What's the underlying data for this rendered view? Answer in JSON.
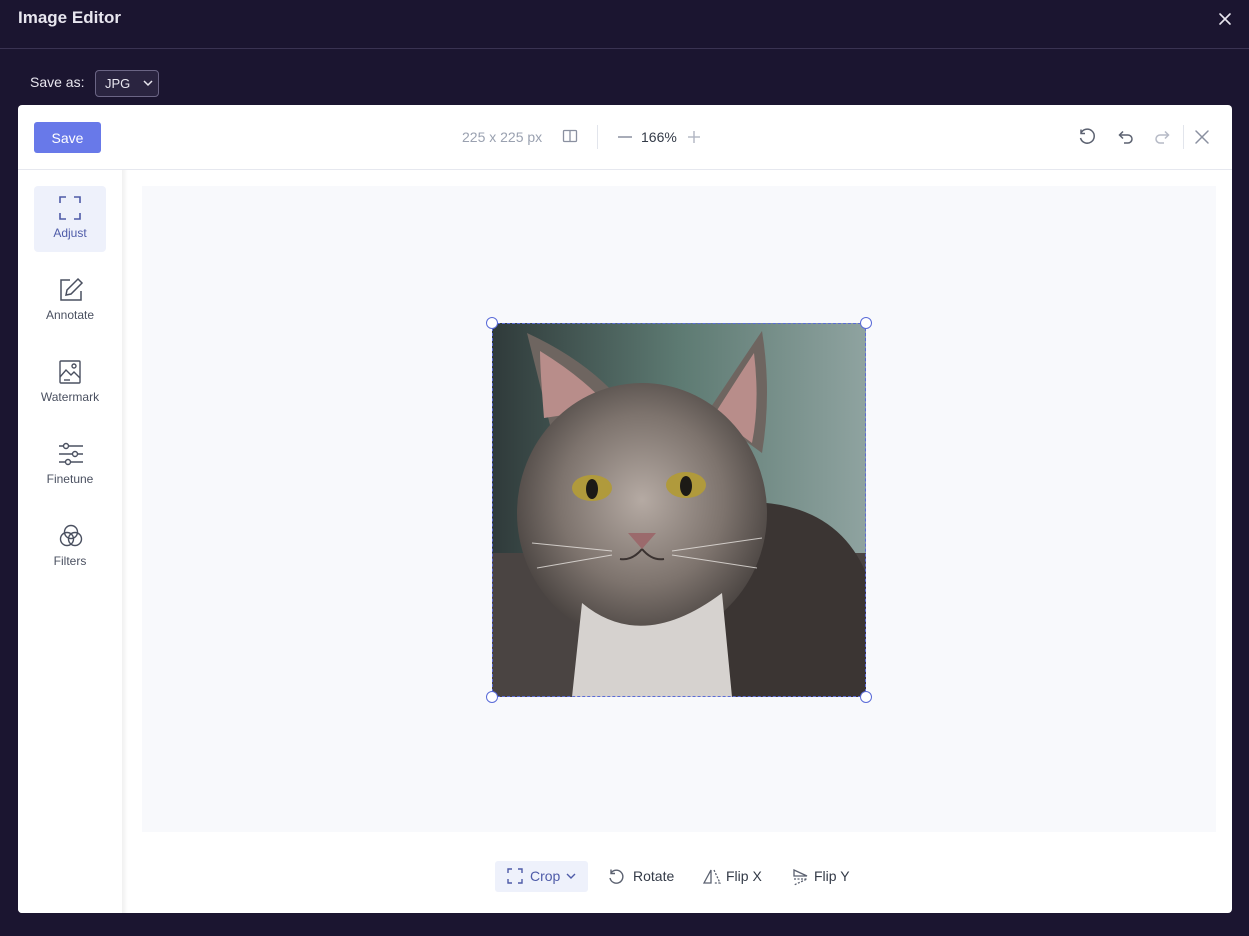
{
  "modal": {
    "title": "Image Editor",
    "save_as_label": "Save as:",
    "format": {
      "selected": "JPG"
    }
  },
  "toolbar": {
    "save_label": "Save",
    "dimensions": "225 x 225 px",
    "zoom": "166%"
  },
  "sidebar": {
    "items": [
      {
        "label": "Adjust",
        "icon": "crop-frame-icon",
        "active": true
      },
      {
        "label": "Annotate",
        "icon": "edit-pencil-icon"
      },
      {
        "label": "Watermark",
        "icon": "image-icon"
      },
      {
        "label": "Finetune",
        "icon": "sliders-icon"
      },
      {
        "label": "Filters",
        "icon": "color-circles-icon"
      }
    ]
  },
  "bottom": {
    "crop_label": "Crop",
    "rotate_label": "Rotate",
    "flip_x_label": "Flip X",
    "flip_y_label": "Flip Y"
  },
  "colors": {
    "accent": "#6879e9",
    "crop_border": "#5a6bd8",
    "modal_bg": "#1b1530"
  }
}
